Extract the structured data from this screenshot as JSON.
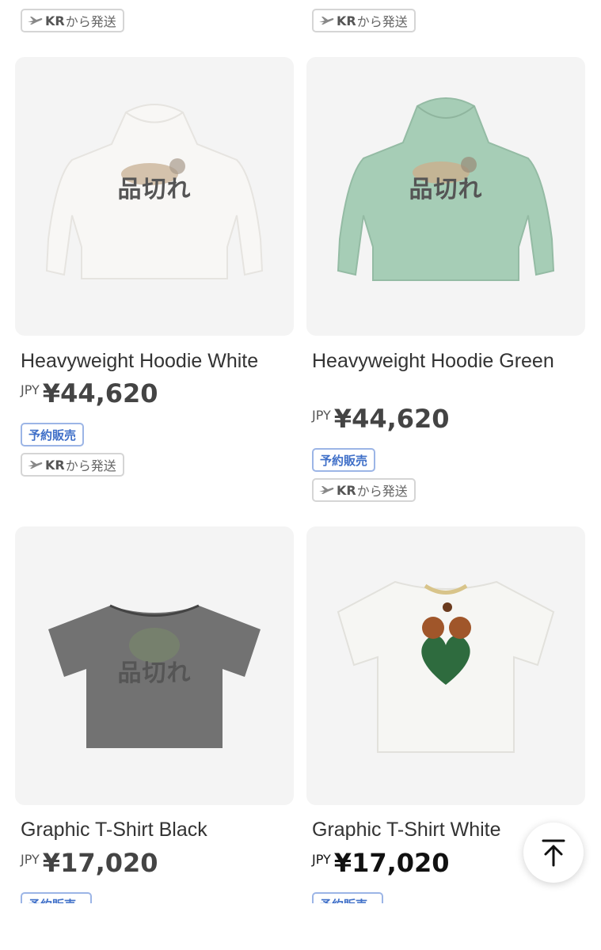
{
  "ship_tag": {
    "code": "KR",
    "suffix": "から発送"
  },
  "preorder_label": "予約販売",
  "soldout_label": "品切れ",
  "currency": "JPY",
  "products": [
    {
      "name": "Heavyweight Hoodie White",
      "price": "¥44,620",
      "soldout": true
    },
    {
      "name": "Heavyweight Hoodie Green",
      "price": "¥44,620",
      "soldout": true
    },
    {
      "name": "Graphic T-Shirt Black",
      "price": "¥17,020",
      "soldout": true
    },
    {
      "name": "Graphic T-Shirt White",
      "price": "¥17,020",
      "soldout": false
    }
  ],
  "colors": {
    "preorder": "#3f6fc8",
    "hoodie_green": "#9fc7b0",
    "tee_black": "#505050"
  },
  "icons": {
    "ship": "airplane-icon",
    "top": "arrow-to-top-icon"
  }
}
